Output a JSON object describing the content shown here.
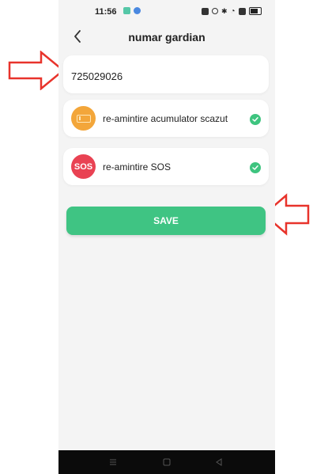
{
  "status_bar": {
    "time": "11:56",
    "left_icons": [
      "message-icon",
      "app-notification-icon"
    ],
    "right_icons": [
      "nfc-icon",
      "data-icon",
      "bluetooth-icon",
      "wifi-icon",
      "sim-icon",
      "battery-icon"
    ]
  },
  "header": {
    "title": "numar gardian",
    "back_icon": "chevron-left-icon"
  },
  "phone_field": {
    "value": "725029026"
  },
  "reminders": [
    {
      "label": "re-amintire acumulator scazut",
      "icon": "battery-icon",
      "icon_color": "#f3a63a",
      "checked": true
    },
    {
      "label": "re-amintire SOS",
      "icon_text": "SOS",
      "icon_color": "#e94253",
      "checked": true
    }
  ],
  "save_button": {
    "label": "SAVE",
    "color": "#3fc483"
  },
  "nav_bar": {
    "buttons": [
      "menu-icon",
      "home-icon",
      "back-icon"
    ]
  },
  "annotation_color": "#e8332b"
}
